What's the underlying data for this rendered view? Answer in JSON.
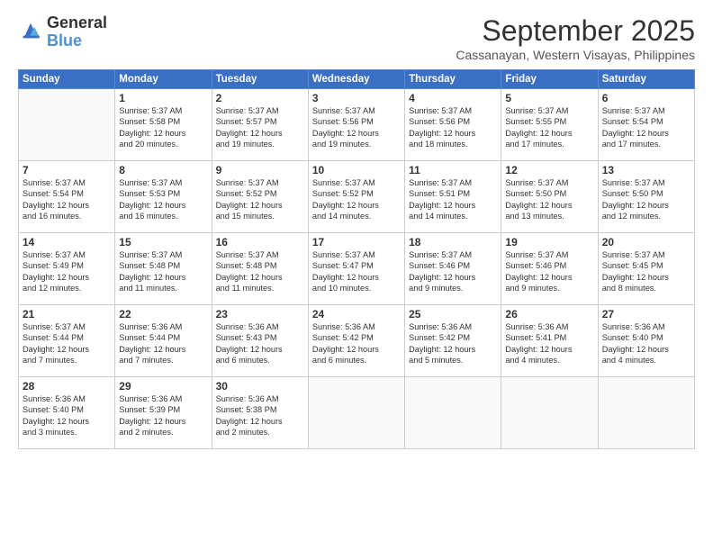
{
  "logo": {
    "line1": "General",
    "line2": "Blue"
  },
  "header": {
    "title": "September 2025",
    "subtitle": "Cassanayan, Western Visayas, Philippines"
  },
  "weekdays": [
    "Sunday",
    "Monday",
    "Tuesday",
    "Wednesday",
    "Thursday",
    "Friday",
    "Saturday"
  ],
  "weeks": [
    [
      {
        "day": "",
        "info": ""
      },
      {
        "day": "1",
        "info": "Sunrise: 5:37 AM\nSunset: 5:58 PM\nDaylight: 12 hours\nand 20 minutes."
      },
      {
        "day": "2",
        "info": "Sunrise: 5:37 AM\nSunset: 5:57 PM\nDaylight: 12 hours\nand 19 minutes."
      },
      {
        "day": "3",
        "info": "Sunrise: 5:37 AM\nSunset: 5:56 PM\nDaylight: 12 hours\nand 19 minutes."
      },
      {
        "day": "4",
        "info": "Sunrise: 5:37 AM\nSunset: 5:56 PM\nDaylight: 12 hours\nand 18 minutes."
      },
      {
        "day": "5",
        "info": "Sunrise: 5:37 AM\nSunset: 5:55 PM\nDaylight: 12 hours\nand 17 minutes."
      },
      {
        "day": "6",
        "info": "Sunrise: 5:37 AM\nSunset: 5:54 PM\nDaylight: 12 hours\nand 17 minutes."
      }
    ],
    [
      {
        "day": "7",
        "info": "Sunrise: 5:37 AM\nSunset: 5:54 PM\nDaylight: 12 hours\nand 16 minutes."
      },
      {
        "day": "8",
        "info": "Sunrise: 5:37 AM\nSunset: 5:53 PM\nDaylight: 12 hours\nand 16 minutes."
      },
      {
        "day": "9",
        "info": "Sunrise: 5:37 AM\nSunset: 5:52 PM\nDaylight: 12 hours\nand 15 minutes."
      },
      {
        "day": "10",
        "info": "Sunrise: 5:37 AM\nSunset: 5:52 PM\nDaylight: 12 hours\nand 14 minutes."
      },
      {
        "day": "11",
        "info": "Sunrise: 5:37 AM\nSunset: 5:51 PM\nDaylight: 12 hours\nand 14 minutes."
      },
      {
        "day": "12",
        "info": "Sunrise: 5:37 AM\nSunset: 5:50 PM\nDaylight: 12 hours\nand 13 minutes."
      },
      {
        "day": "13",
        "info": "Sunrise: 5:37 AM\nSunset: 5:50 PM\nDaylight: 12 hours\nand 12 minutes."
      }
    ],
    [
      {
        "day": "14",
        "info": "Sunrise: 5:37 AM\nSunset: 5:49 PM\nDaylight: 12 hours\nand 12 minutes."
      },
      {
        "day": "15",
        "info": "Sunrise: 5:37 AM\nSunset: 5:48 PM\nDaylight: 12 hours\nand 11 minutes."
      },
      {
        "day": "16",
        "info": "Sunrise: 5:37 AM\nSunset: 5:48 PM\nDaylight: 12 hours\nand 11 minutes."
      },
      {
        "day": "17",
        "info": "Sunrise: 5:37 AM\nSunset: 5:47 PM\nDaylight: 12 hours\nand 10 minutes."
      },
      {
        "day": "18",
        "info": "Sunrise: 5:37 AM\nSunset: 5:46 PM\nDaylight: 12 hours\nand 9 minutes."
      },
      {
        "day": "19",
        "info": "Sunrise: 5:37 AM\nSunset: 5:46 PM\nDaylight: 12 hours\nand 9 minutes."
      },
      {
        "day": "20",
        "info": "Sunrise: 5:37 AM\nSunset: 5:45 PM\nDaylight: 12 hours\nand 8 minutes."
      }
    ],
    [
      {
        "day": "21",
        "info": "Sunrise: 5:37 AM\nSunset: 5:44 PM\nDaylight: 12 hours\nand 7 minutes."
      },
      {
        "day": "22",
        "info": "Sunrise: 5:36 AM\nSunset: 5:44 PM\nDaylight: 12 hours\nand 7 minutes."
      },
      {
        "day": "23",
        "info": "Sunrise: 5:36 AM\nSunset: 5:43 PM\nDaylight: 12 hours\nand 6 minutes."
      },
      {
        "day": "24",
        "info": "Sunrise: 5:36 AM\nSunset: 5:42 PM\nDaylight: 12 hours\nand 6 minutes."
      },
      {
        "day": "25",
        "info": "Sunrise: 5:36 AM\nSunset: 5:42 PM\nDaylight: 12 hours\nand 5 minutes."
      },
      {
        "day": "26",
        "info": "Sunrise: 5:36 AM\nSunset: 5:41 PM\nDaylight: 12 hours\nand 4 minutes."
      },
      {
        "day": "27",
        "info": "Sunrise: 5:36 AM\nSunset: 5:40 PM\nDaylight: 12 hours\nand 4 minutes."
      }
    ],
    [
      {
        "day": "28",
        "info": "Sunrise: 5:36 AM\nSunset: 5:40 PM\nDaylight: 12 hours\nand 3 minutes."
      },
      {
        "day": "29",
        "info": "Sunrise: 5:36 AM\nSunset: 5:39 PM\nDaylight: 12 hours\nand 2 minutes."
      },
      {
        "day": "30",
        "info": "Sunrise: 5:36 AM\nSunset: 5:38 PM\nDaylight: 12 hours\nand 2 minutes."
      },
      {
        "day": "",
        "info": ""
      },
      {
        "day": "",
        "info": ""
      },
      {
        "day": "",
        "info": ""
      },
      {
        "day": "",
        "info": ""
      }
    ]
  ]
}
